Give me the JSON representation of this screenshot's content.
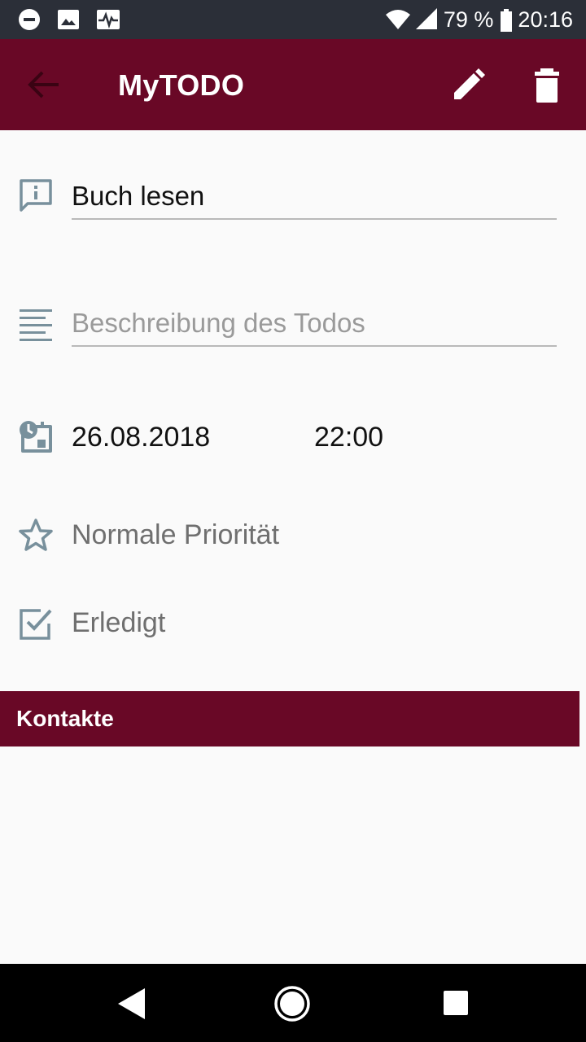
{
  "status_bar": {
    "battery": "79 %",
    "time": "20:16",
    "icons": [
      "do-not-disturb-icon",
      "image-icon",
      "activity-icon",
      "wifi-icon",
      "signal-icon",
      "battery-icon"
    ]
  },
  "app_bar": {
    "title": "MyTODO",
    "icons": [
      "back-arrow-icon",
      "pencil-icon",
      "trash-icon"
    ]
  },
  "todo": {
    "title_value": "Buch lesen",
    "description_placeholder": "Beschreibung des Todos",
    "date": "26.08.2018",
    "time": "22:00",
    "priority_label": "Normale Priorität",
    "done_label": "Erledigt"
  },
  "contacts": {
    "header": "Kontakte"
  },
  "nav_bar": {
    "icons": [
      "nav-back-icon",
      "nav-home-icon",
      "nav-recents-icon"
    ]
  },
  "colors": {
    "primary": "#690826",
    "status_bar": "#2b2f38",
    "background": "#fafafa",
    "icon_gray": "#78909c"
  }
}
